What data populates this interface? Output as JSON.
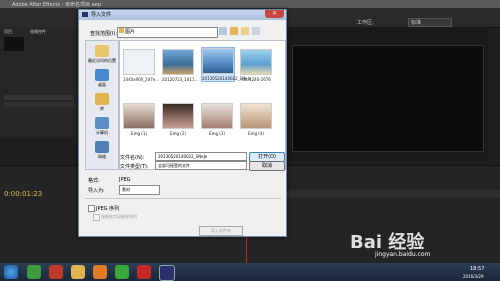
{
  "app": {
    "title": "Adobe After Effects - 未命名项目.aep",
    "workspace_label": "工作区:",
    "workspace_value": "标准",
    "panels": {
      "project_tab": "项目",
      "effects_tab": "效果控件",
      "timecode": "0:00:01:23"
    }
  },
  "dialog": {
    "title": "导入文件",
    "look_in_label": "查找范围(I):",
    "look_in_value": "图片",
    "places": [
      {
        "label": "最近访问的位置",
        "icon": "recent-icon",
        "color": "#e8c66a"
      },
      {
        "label": "桌面",
        "icon": "desktop-icon",
        "color": "#4a88cf"
      },
      {
        "label": "库",
        "icon": "library-icon",
        "color": "#e0b450"
      },
      {
        "label": "计算机",
        "icon": "computer-icon",
        "color": "#5b8fc6"
      },
      {
        "label": "网络",
        "icon": "network-icon",
        "color": "#4f7fb4"
      }
    ],
    "files": [
      {
        "name": "1440x900_2d7e...",
        "color": "#eef1f5"
      },
      {
        "name": "20120723_1411...",
        "color": "#5a8bb5"
      },
      {
        "name": "20130520140022_SNeJe",
        "color": "#6fa4d8",
        "selected": true
      },
      {
        "name": "ntk-1246-2676",
        "color": "#7fb5d9"
      },
      {
        "name": "Emg (1)",
        "color": "#b79b8a"
      },
      {
        "name": "Emg (2)",
        "color": "#7a5a52"
      },
      {
        "name": "Emg (3)",
        "color": "#c9b0a4"
      },
      {
        "name": "Emg (4)",
        "color": "#d7c0a8"
      }
    ],
    "filename_label": "文件名(N):",
    "filename_value": "20130520140022_SNeJe",
    "filetype_label": "文件类型(T):",
    "filetype_value": "全部可接受的文件",
    "open_label": "打开(O)",
    "cancel_label": "取消",
    "format_label": "格式:",
    "format_value": "JPEG",
    "import_as_label": "导入为:",
    "import_as_value": "素材",
    "jpeg_sequence_label": "JPEG 序列",
    "force_alpha_label": "强制按字母顺序排列",
    "import_folder_label": "导入文件夹"
  },
  "watermark": {
    "brand": "Bai 经验",
    "url": "jingyan.baidu.com"
  },
  "taskbar": {
    "time": "18:57",
    "date": "2016/3/29"
  }
}
